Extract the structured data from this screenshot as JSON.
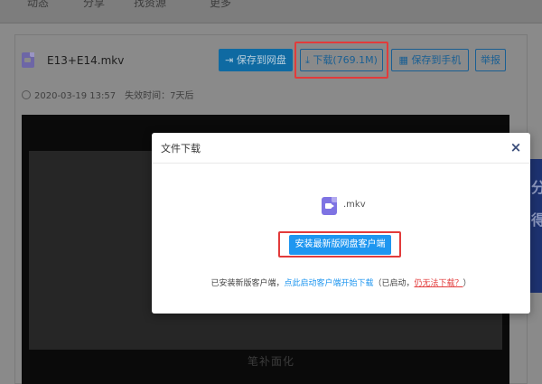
{
  "nav": {
    "items": [
      "动态",
      "分享",
      "找资源",
      "更多"
    ]
  },
  "file": {
    "name": "E13+E14.mkv",
    "icon": "video-file-icon",
    "date": "2020-03-19 13:57",
    "expiry": "失效时间：7天后"
  },
  "toolbar": {
    "save_cloud_label": "保存到网盘",
    "download_label": "下载(769.1M)",
    "save_phone_label": "保存到手机",
    "report_label": "举报"
  },
  "video": {
    "caption": "笔补面化"
  },
  "side_ad": {
    "glyphs": [
      "分",
      "得"
    ]
  },
  "modal": {
    "title": "文件下载",
    "close": "×",
    "file_ext": ".mkv",
    "install_label": "安装最新版网盘客户端",
    "footer_prefix": "已安装新版客户端，",
    "footer_link": "点此启动客户端开始下载",
    "footer_middle": "（已启动，",
    "footer_warn": "仍无法下载？",
    "footer_suffix": "）"
  },
  "colors": {
    "accent_blue": "#1e96f0",
    "highlight_red": "#e23b3b",
    "file_icon_purple": "#7e73e3"
  }
}
